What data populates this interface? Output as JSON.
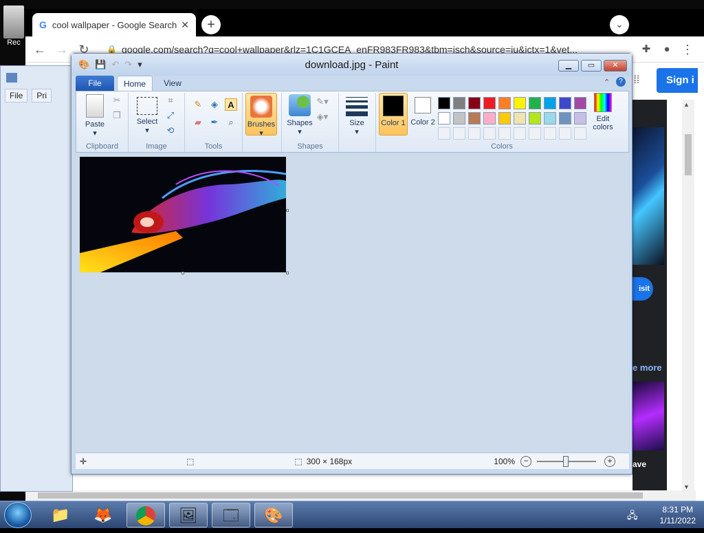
{
  "desktop": {
    "icon_label": "Rec"
  },
  "chrome": {
    "tab_title": "cool wallpaper - Google Search",
    "url": "google.com/search?q=cool+wallpaper&rlz=1C1GCEA_enFR983FR983&tbm=isch&source=iu&ictx=1&vet...",
    "signin": "Sign i",
    "visit": "isit",
    "see_more": "e more",
    "save": "ave"
  },
  "bgwin": {
    "menu_file": "File",
    "menu_print": "Pri"
  },
  "paint": {
    "title": "download.jpg - Paint",
    "tabs": {
      "file": "File",
      "home": "Home",
      "view": "View"
    },
    "clipboard": {
      "paste": "Paste",
      "label": "Clipboard"
    },
    "image": {
      "select": "Select",
      "label": "Image"
    },
    "tools": {
      "label": "Tools"
    },
    "brushes": "Brushes",
    "shapes": {
      "button": "Shapes",
      "label": "Shapes"
    },
    "size": "Size",
    "color1": "Color 1",
    "color2": "Color 2",
    "colors": {
      "label": "Colors",
      "edit": "Edit colors",
      "palette_row1": [
        "#000000",
        "#7f7f7f",
        "#880015",
        "#ed1c24",
        "#ff7f27",
        "#fff200",
        "#22b14c",
        "#00a2e8",
        "#3f48cc",
        "#a349a4"
      ],
      "palette_row2": [
        "#ffffff",
        "#c3c3c3",
        "#b97a57",
        "#ffaec9",
        "#ffc90e",
        "#efe4b0",
        "#b5e61d",
        "#99d9ea",
        "#7092be",
        "#c8bfe7"
      ],
      "color1_value": "#000000",
      "color2_value": "#ffffff"
    },
    "status": {
      "dimensions": "300 × 168px",
      "zoom": "100%"
    }
  },
  "taskbar": {
    "time": "8:31 PM",
    "date": "1/11/2022"
  }
}
